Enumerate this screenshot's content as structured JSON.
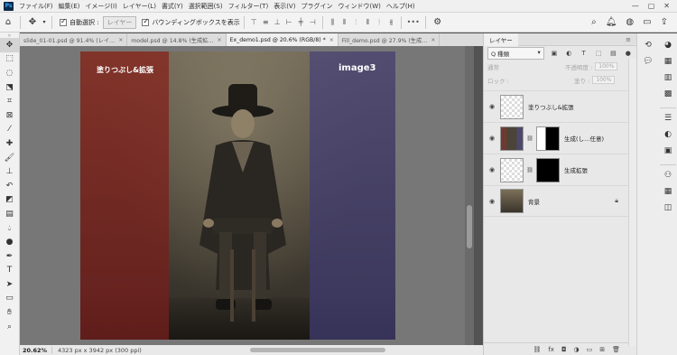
{
  "menubar": {
    "logo": "Ps",
    "items": [
      "ファイル(F)",
      "編集(E)",
      "イメージ(I)",
      "レイヤー(L)",
      "書式(Y)",
      "選択範囲(S)",
      "フィルター(T)",
      "表示(V)",
      "プラグイン",
      "ウィンドウ(W)",
      "ヘルプ(H)"
    ],
    "window_controls": [
      "—",
      "▢",
      "✕"
    ]
  },
  "options": {
    "auto_select_label": "自動選択 :",
    "auto_select_value": "レイヤー",
    "bounding_box_label": "バウンディングボックスを表示",
    "more": "•••"
  },
  "tabs": [
    {
      "label": "slide_01-01.psd @ 91.4% (レイ…",
      "close": "×"
    },
    {
      "label": "model.psd @ 14.8% (生成拡…",
      "close": "×"
    },
    {
      "label": "Ex_demo1.psd @ 20.6% (RGB/8) *",
      "close": "×"
    },
    {
      "label": "Fill_demo.psd @ 27.9% (生成…",
      "close": "×"
    }
  ],
  "canvas": {
    "label_left": "塗りつぶし&拡張",
    "label_right": "image3"
  },
  "status": {
    "zoom": "20.62%",
    "doc_info": "4323 px x 3942 px (300 ppi)"
  },
  "layers_panel": {
    "title": "レイヤー",
    "filter_kind": "Q 種類",
    "blend_mode": "通常",
    "opacity_label": "不透明度 :",
    "opacity_value": "100%",
    "lock_label": "ロック :",
    "fill_label": "塗り :",
    "fill_value": "100%",
    "layers": [
      {
        "name": "塗りつぶし&拡張"
      },
      {
        "name": "生成(し…任意)"
      },
      {
        "name": "生成拡張"
      },
      {
        "name": "背景"
      }
    ]
  }
}
